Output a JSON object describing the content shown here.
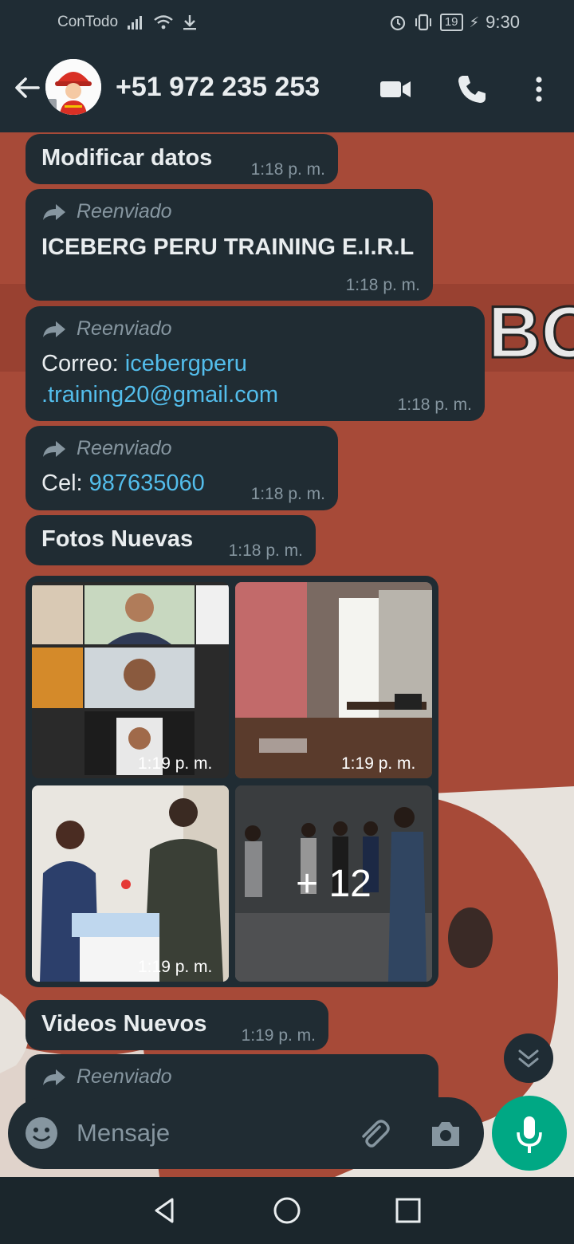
{
  "status_bar": {
    "carrier": "ConTodo",
    "battery": "19",
    "time": "9:30"
  },
  "header": {
    "contact": "+51 972 235 253",
    "icons": [
      "back-arrow-icon",
      "video-call-icon",
      "phone-icon",
      "more-vert-icon"
    ]
  },
  "messages": [
    {
      "text": "Modificar datos",
      "time": "1:18 p. m."
    },
    {
      "forwarded": "Reenviado",
      "text": "ICEBERG PERU TRAINING E.I.R.L",
      "time": "1:18 p. m."
    },
    {
      "forwarded": "Reenviado",
      "prefix": "Correo: ",
      "link_line1": "icebergperu",
      "link_line2": ".training20@gmail.com",
      "time": "1:18 p. m."
    },
    {
      "forwarded": "Reenviado",
      "prefix": "Cel: ",
      "link": "987635060",
      "time": "1:18 p. m."
    },
    {
      "text": "Fotos Nuevas",
      "time": "1:18 p. m."
    },
    {
      "text": "Videos Nuevos",
      "time": "1:19 p. m."
    },
    {
      "forwarded": "Reenviado"
    }
  ],
  "photo_album": {
    "items": [
      {
        "time": "1:19 p. m."
      },
      {
        "time": "1:19 p. m."
      },
      {
        "time": "1:19 p. m."
      },
      {
        "more": "+ 12"
      }
    ]
  },
  "composer": {
    "placeholder": "Mensaje"
  },
  "colors": {
    "bubble": "#202c33",
    "header": "#1f2c34",
    "accent": "#00a884",
    "link": "#53bdeb"
  }
}
